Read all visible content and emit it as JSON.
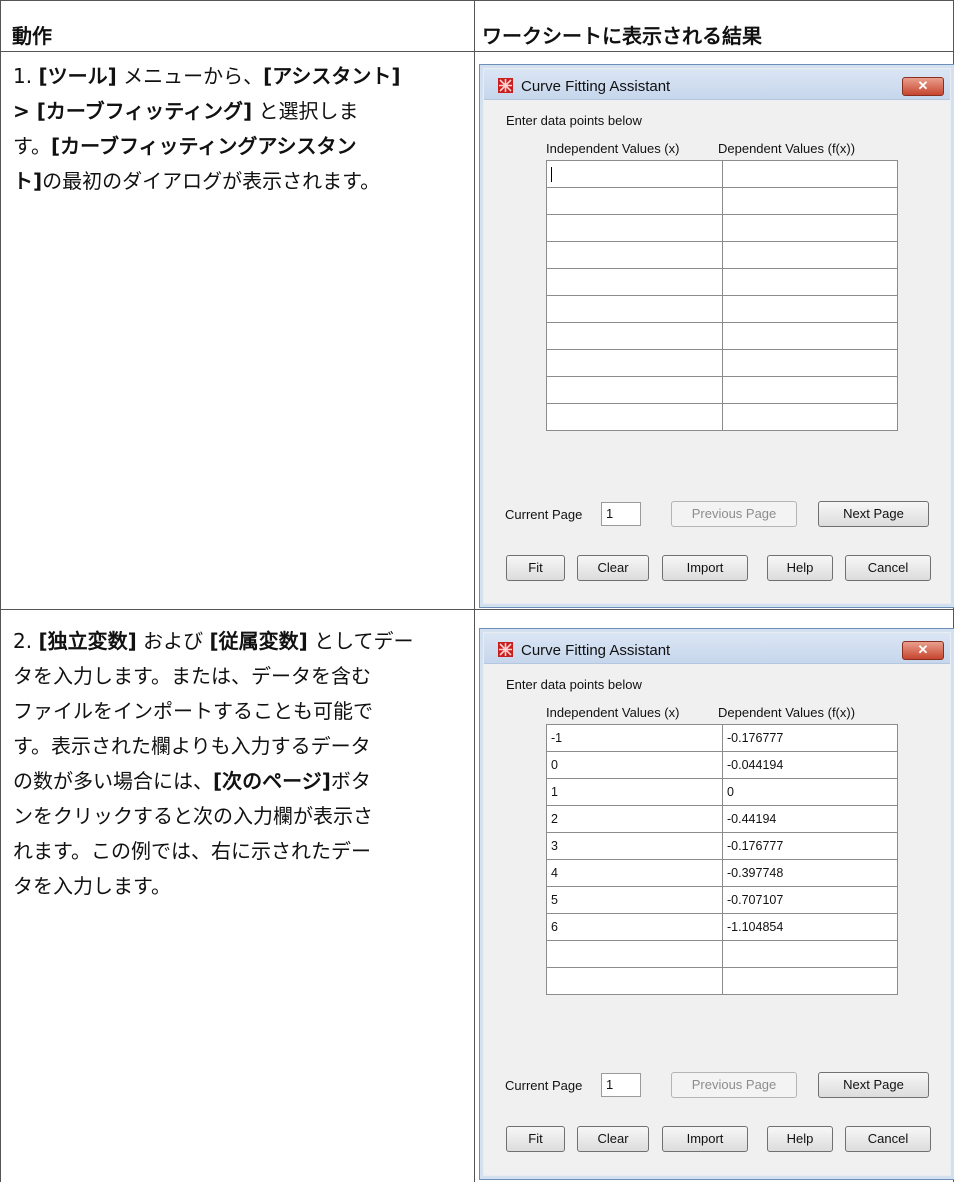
{
  "table": {
    "col_action": "動作",
    "col_result": "ワークシートに表示される結果"
  },
  "steps": [
    {
      "lines": [
        [
          {
            "t": "1. ",
            "b": false
          },
          {
            "t": "[ツール]",
            "b": true
          },
          {
            "t": " メニューから、",
            "b": false
          },
          {
            "t": "[アシスタント]",
            "b": true
          }
        ],
        [
          {
            "t": "> [カーブフィッティング]",
            "b": true
          },
          {
            "t": " と選択しま",
            "b": false
          }
        ],
        [
          {
            "t": "す。",
            "b": false
          },
          {
            "t": "[カーブフィッティングアシスタン",
            "b": true
          }
        ],
        [
          {
            "t": "ト]",
            "b": true
          },
          {
            "t": "の最初のダイアログが表示されます。",
            "b": false
          }
        ]
      ]
    },
    {
      "lines": [
        [
          {
            "t": "2. ",
            "b": false
          },
          {
            "t": "[独立変数]",
            "b": true
          },
          {
            "t": " および ",
            "b": false
          },
          {
            "t": "[従属変数]",
            "b": true
          },
          {
            "t": " としてデー",
            "b": false
          }
        ],
        [
          {
            "t": "タを入力します。または、データを含む",
            "b": false
          }
        ],
        [
          {
            "t": "ファイルをインポートすることも可能で",
            "b": false
          }
        ],
        [
          {
            "t": "す。表示された欄よりも入力するデータ",
            "b": false
          }
        ],
        [
          {
            "t": "の数が多い場合には、",
            "b": false
          },
          {
            "t": "[次のページ]",
            "b": true
          },
          {
            "t": "ボタ",
            "b": false
          }
        ],
        [
          {
            "t": "ンをクリックすると次の入力欄が表示さ",
            "b": false
          }
        ],
        [
          {
            "t": "れます。この例では、右に示されたデー",
            "b": false
          }
        ],
        [
          {
            "t": "タを入力します。",
            "b": false
          }
        ]
      ]
    }
  ],
  "dialog": {
    "title": "Curve Fitting Assistant",
    "close_label": "✕",
    "prompt": "Enter data points below",
    "col_x": "Independent Values (x)",
    "col_fx": "Dependent Values (f(x))",
    "current_page_label": "Current Page",
    "current_page_value": "1",
    "prev_label": "Previous Page",
    "next_label": "Next Page",
    "fit_label": "Fit",
    "clear_label": "Clear",
    "import_label": "Import",
    "help_label": "Help",
    "cancel_label": "Cancel"
  },
  "dialog1_rows": [
    [
      "",
      ""
    ],
    [
      "",
      ""
    ],
    [
      "",
      ""
    ],
    [
      "",
      ""
    ],
    [
      "",
      ""
    ],
    [
      "",
      ""
    ],
    [
      "",
      ""
    ],
    [
      "",
      ""
    ],
    [
      "",
      ""
    ],
    [
      "",
      ""
    ]
  ],
  "dialog2_rows": [
    [
      "-1",
      "-0.176777"
    ],
    [
      "0",
      "-0.044194"
    ],
    [
      "1",
      "0"
    ],
    [
      "2",
      "-0.44194"
    ],
    [
      "3",
      "-0.176777"
    ],
    [
      "4",
      "-0.397748"
    ],
    [
      "5",
      "-0.707107"
    ],
    [
      "6",
      "-1.104854"
    ],
    [
      "",
      ""
    ],
    [
      "",
      ""
    ]
  ],
  "colors": {
    "close": "#c6452f",
    "border": "#6e8fb8"
  },
  "icons": {
    "app": "maple-leaf-icon",
    "close": "close-icon"
  }
}
